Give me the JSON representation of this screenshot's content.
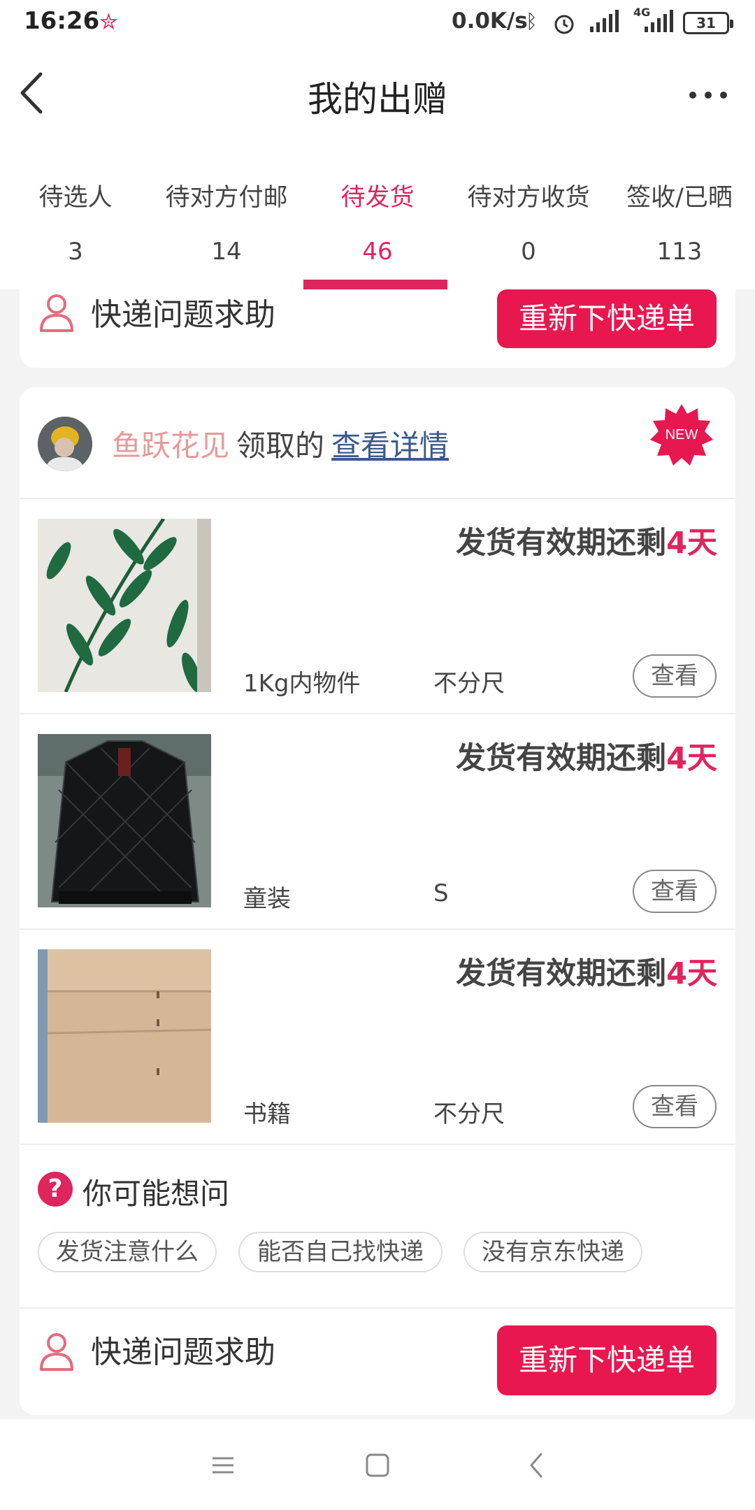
{
  "status_bar": {
    "time": "16:26",
    "network_speed": "0.0K/s",
    "network_type": "4G",
    "battery": "31"
  },
  "header": {
    "title": "我的出赠"
  },
  "tabs": [
    {
      "label": "待选人",
      "count": "3",
      "active": false
    },
    {
      "label": "待对方付邮",
      "count": "14",
      "active": false
    },
    {
      "label": "待发货",
      "count": "46",
      "active": true
    },
    {
      "label": "待对方收货",
      "count": "0",
      "active": false
    },
    {
      "label": "签收/已晒",
      "count": "113",
      "active": false
    }
  ],
  "top_help": {
    "label": "快递问题求助",
    "button": "重新下快递单"
  },
  "card": {
    "user_name": "鱼跃花见",
    "claimed_text": "领取的",
    "detail_link": "查看详情",
    "new_badge": "NEW",
    "items": [
      {
        "deadline_prefix": "发货有效期还剩",
        "deadline_days": "4天",
        "category": "1Kg内物件",
        "size": "不分尺",
        "view_label": "查看"
      },
      {
        "deadline_prefix": "发货有效期还剩",
        "deadline_days": "4天",
        "category": "童装",
        "size": "S",
        "view_label": "查看"
      },
      {
        "deadline_prefix": "发货有效期还剩",
        "deadline_days": "4天",
        "category": "书籍",
        "size": "不分尺",
        "view_label": "查看"
      }
    ],
    "faq": {
      "icon": "?",
      "title": "你可能想问",
      "chips": [
        "发货注意什么",
        "能否自己找快递",
        "没有京东快递"
      ]
    },
    "bottom_help": {
      "label": "快递问题求助",
      "button": "重新下快递单"
    }
  },
  "colors": {
    "accent": "#e0245e",
    "button": "#e8174f",
    "link": "#3b5a8a",
    "username": "#e79a9a"
  }
}
